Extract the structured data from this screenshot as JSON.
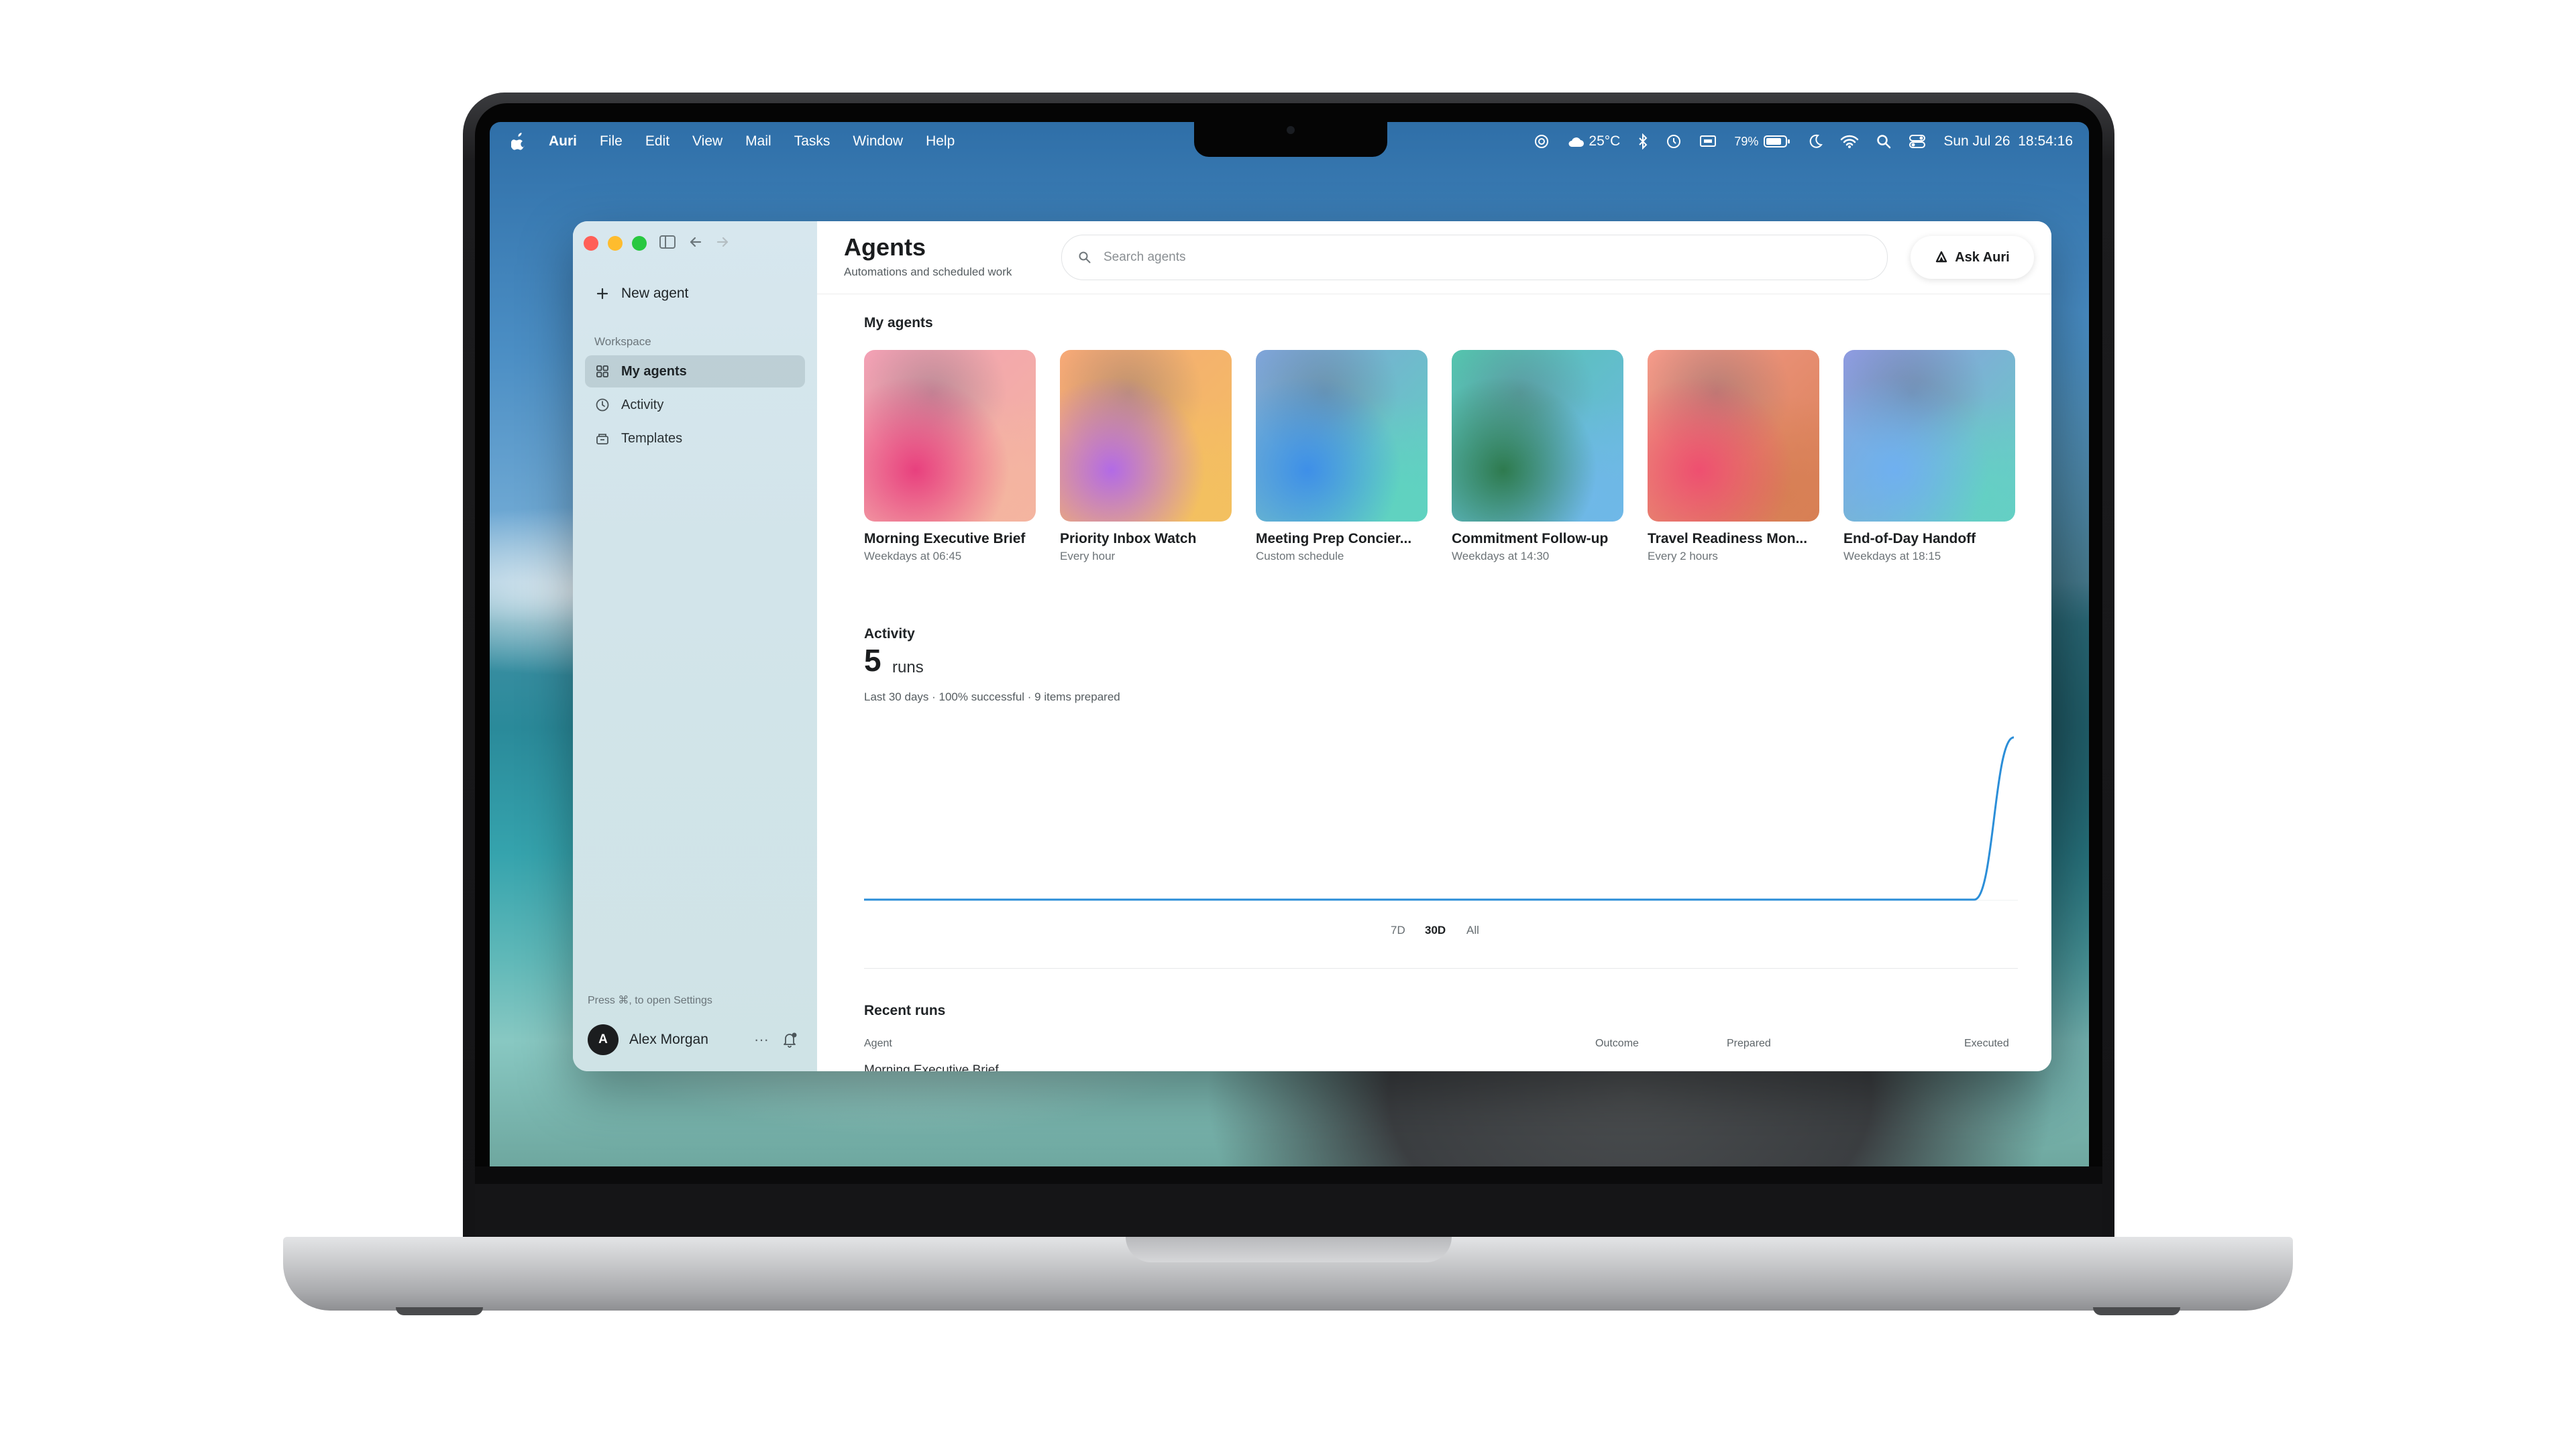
{
  "menubar": {
    "app_name": "Auri",
    "menus": [
      "File",
      "Edit",
      "View",
      "Mail",
      "Tasks",
      "Window",
      "Help"
    ],
    "weather": "25°C",
    "battery": "79%",
    "datetime": "Sun Jul 26  18:54:16"
  },
  "sidebar": {
    "new_agent": "New agent",
    "section": "Workspace",
    "items": [
      {
        "label": "My agents",
        "icon": "grid-icon",
        "active": true
      },
      {
        "label": "Activity",
        "icon": "clock-icon",
        "active": false
      },
      {
        "label": "Templates",
        "icon": "template-icon",
        "active": false
      }
    ],
    "hint": "Press ⌘, to open Settings",
    "user": {
      "initial": "A",
      "name": "Alex Morgan"
    }
  },
  "header": {
    "title": "Agents",
    "subtitle": "Automations and scheduled work",
    "search_placeholder": "Search agents",
    "ask_button": "Ask Auri"
  },
  "agents": {
    "section_title": "My agents",
    "items": [
      {
        "name": "Morning Executive Brief",
        "schedule": "Weekdays at 06:45",
        "colors": [
          "#f2a0b4",
          "#e8407e",
          "#f4b5a0"
        ]
      },
      {
        "name": "Priority Inbox Watch",
        "schedule": "Every hour",
        "colors": [
          "#f5a877",
          "#b26ae6",
          "#f3c060"
        ]
      },
      {
        "name": "Meeting Prep Concier...",
        "schedule": "Custom schedule",
        "colors": [
          "#7fa3d8",
          "#3e8fe8",
          "#5fd3c0"
        ]
      },
      {
        "name": "Commitment Follow-up",
        "schedule": "Weekdays at 14:30",
        "colors": [
          "#54c3ac",
          "#2e7a4e",
          "#6fb8e8"
        ]
      },
      {
        "name": "Travel Readiness Mon...",
        "schedule": "Every 2 hours",
        "colors": [
          "#f49a8a",
          "#ee4f70",
          "#d77f54"
        ]
      },
      {
        "name": "End-of-Day Handoff",
        "schedule": "Weekdays at 18:15",
        "colors": [
          "#8e9ae0",
          "#6fb0f0",
          "#64d0c4"
        ]
      }
    ]
  },
  "activity": {
    "section_title": "Activity",
    "runs": "5",
    "runs_label": "runs",
    "meta": "Last 30 days · 100% successful · 9 items prepared",
    "ranges": [
      "7D",
      "30D",
      "All"
    ],
    "selected_range": "30D"
  },
  "chart_data": {
    "type": "line",
    "title": "",
    "xlabel": "",
    "ylabel": "",
    "series": [
      {
        "values": [
          0,
          0,
          0,
          0,
          0,
          0,
          0,
          0,
          0,
          0,
          0,
          0,
          0,
          0,
          0,
          0,
          0,
          0,
          0,
          0,
          0,
          0,
          0,
          0,
          0,
          0,
          0,
          0,
          0,
          5
        ]
      }
    ],
    "ylim": [
      0,
      5
    ],
    "grid": false,
    "color": "#2b8ed8"
  },
  "recent_runs": {
    "section_title": "Recent runs",
    "columns": [
      "Agent",
      "Outcome",
      "Prepared",
      "Executed"
    ],
    "first_row_partial": "Morning Executive Brief"
  }
}
